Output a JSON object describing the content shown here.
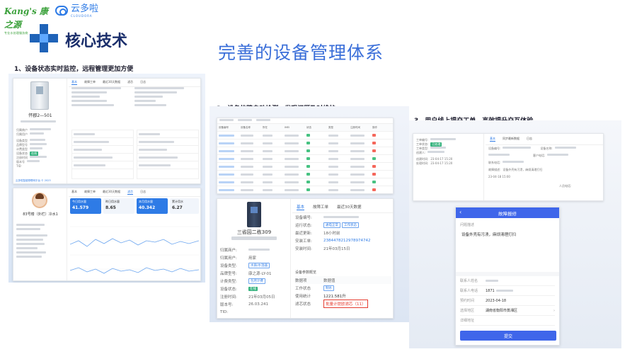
{
  "header": {
    "logo_kangs": "Kang's 康之源",
    "logo_kangs_sub": "专业水处理服务商",
    "logo_cloud": "云多啦",
    "logo_cloud_sub": "CLOUDORA"
  },
  "section_title": "核心技术",
  "main_title": "完善的设备管理体系",
  "features": [
    "1、设备状态实时监控，远程管理更加方便",
    "2、设备故障自动检测，发现问题及时维护",
    "3、用户线上提交工单，高效提升交互体验"
  ],
  "panel1": {
    "device_name": "怀郡2—501",
    "tabs": [
      "基本",
      "故障工单",
      "最近30天数据",
      "滤芯",
      "日志"
    ],
    "left_labels": [
      "归属商户",
      "归属用户",
      "设备类型",
      "品牌型号",
      "计费类型",
      "设备状态",
      "注册时间",
      "版本号",
      "TID"
    ],
    "tag": "在线",
    "footer": "云多啦智能物联网平台 © 2023"
  },
  "panel2": {
    "device_name": "83号楼（外栏）冷水1",
    "tabs": [
      "基本",
      "故障工单",
      "最近30天数据",
      "滤芯",
      "日志"
    ],
    "stats": [
      {
        "label": "今日用水量",
        "value": "41.579"
      },
      {
        "label": "昨日用水量",
        "value": "8.65"
      },
      {
        "label": "本月用水量",
        "value": "40.342"
      },
      {
        "label": "累计用水",
        "value": "6.27"
      }
    ]
  },
  "panel3": {
    "headers": [
      "设备编号",
      "设备名称",
      "所在",
      "IMEI",
      "状态",
      "类型",
      "注册时间",
      "操作"
    ]
  },
  "panel4": {
    "device_name": "三省园二栋309",
    "tabs": [
      "基本",
      "故障工单",
      "最近30天数据"
    ],
    "left_rows": [
      {
        "label": "归属商户:",
        "value": ""
      },
      {
        "label": "归属用户:",
        "value": "用家"
      },
      {
        "label": "设备类型:",
        "value": "水质/水温器"
      },
      {
        "label": "品牌型号:",
        "value": "康之源-LY-01"
      },
      {
        "label": "计费类型:",
        "value": "包月计费"
      },
      {
        "label": "设备状态:",
        "value": "在线"
      },
      {
        "label": "注册时间:",
        "value": "21年03月05日"
      },
      {
        "label": "版本号:",
        "value": "26.03.241"
      },
      {
        "label": "TID:",
        "value": ""
      }
    ],
    "right_rows": [
      {
        "label": "设备编号:",
        "value": ""
      },
      {
        "label": "运行状态:",
        "tags": [
          "通电正常",
          "工作状态"
        ]
      },
      {
        "label": "最近更新:",
        "value": "18小时前"
      },
      {
        "label": "安装工单:",
        "value": "2384478212978974742"
      },
      {
        "label": "安装时间:",
        "value": "21年03月15日"
      }
    ],
    "section_label": "设备参数概览",
    "param_headers": [
      "数据项",
      "数据值"
    ],
    "params": [
      {
        "label": "工作状态",
        "value": "制水"
      },
      {
        "label": "使用统计",
        "value": "1221.581升"
      },
      {
        "label": "滤芯状态",
        "value": "批量计提欧滤芯（11）"
      }
    ]
  },
  "panel5": {
    "tabs": [
      "基本",
      "同步最新数据",
      "日志"
    ],
    "labels": [
      "工单编号:",
      "工单状态:",
      "工单类型:",
      "创建人:",
      "设备编号:",
      "设备名称:",
      "客户电话:",
      "联系电话:",
      "故障描述:",
      "创建时间:",
      "处理时间:"
    ],
    "tag": "已处理",
    "dates": [
      "23-04-17 15:20",
      "23-04-17 15:20",
      "23-04-18 15:00"
    ],
    "description": "设备外壳有污渍，麻烦清理打扫",
    "person_label": "人员电话:"
  },
  "phone": {
    "title": "故障报修",
    "problem_label": "问题描述",
    "problem_text": "设备外壳有污渍，麻烦清理打扫",
    "fields": [
      {
        "label": "联系人姓名",
        "value": ""
      },
      {
        "label": "联系人电话",
        "value": "1871"
      },
      {
        "label": "预约时间",
        "value": "2023-04-18"
      },
      {
        "label": "选择地区",
        "value": "湖南省衡阳市蒸湘区"
      },
      {
        "label": "详细地址",
        "value": ""
      }
    ],
    "submit": "提交"
  },
  "colors": {
    "brand_blue": "#3b6fd9",
    "dark_navy": "#1a2e6b",
    "accent": "#2e7be6",
    "success": "#36b37e",
    "alert": "#e53b2f"
  }
}
